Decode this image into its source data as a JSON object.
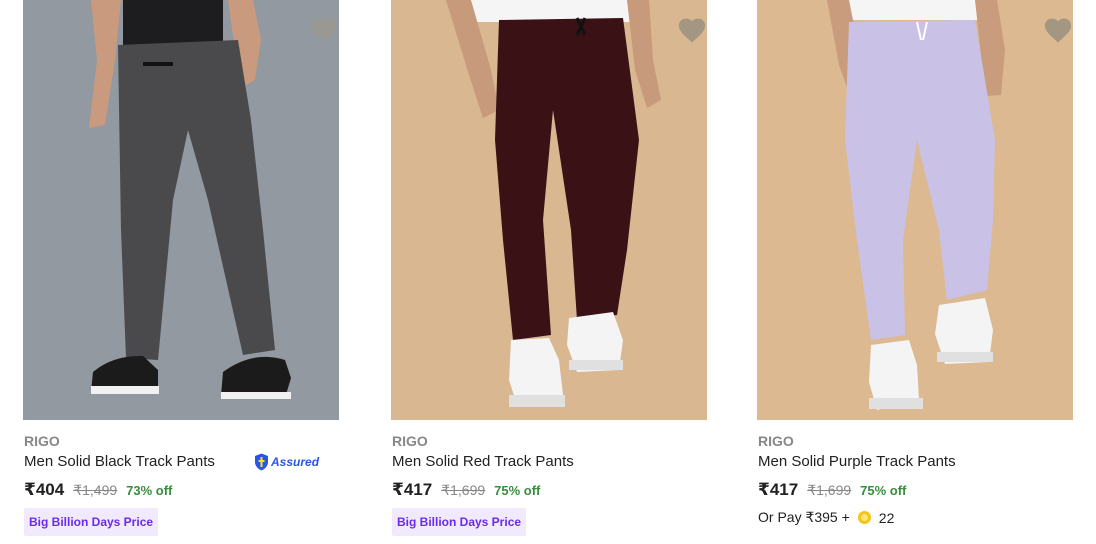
{
  "products": [
    {
      "brand": "RIGO",
      "title": "Men Solid Black Track Pants",
      "price": "₹404",
      "mrp": "₹1,499",
      "discount": "73% off",
      "assured_label": "Assured",
      "badge": "Big Billion Days Price",
      "image_bg": "#8e959c",
      "pants_color": "#4a4a4c",
      "wishlist_icon": "heart-icon"
    },
    {
      "brand": "RIGO",
      "title": "Men Solid Red Track Pants",
      "price": "₹417",
      "mrp": "₹1,699",
      "discount": "75% off",
      "badge": "Big Billion Days Price",
      "image_bg": "#d8b791",
      "pants_color": "#3a1216",
      "wishlist_icon": "heart-icon"
    },
    {
      "brand": "RIGO",
      "title": "Men Solid Purple Track Pants",
      "price": "₹417",
      "mrp": "₹1,699",
      "discount": "75% off",
      "or_pay_text": "Or Pay ₹395 +",
      "supercoins": "22",
      "image_bg": "#dcb990",
      "pants_color": "#c9c2e6",
      "wishlist_icon": "heart-icon"
    }
  ],
  "colors": {
    "discount_green": "#388e3c",
    "badge_purple": "#6a2be8",
    "badge_bg": "#f1eafd",
    "muted_gray": "#878787"
  }
}
